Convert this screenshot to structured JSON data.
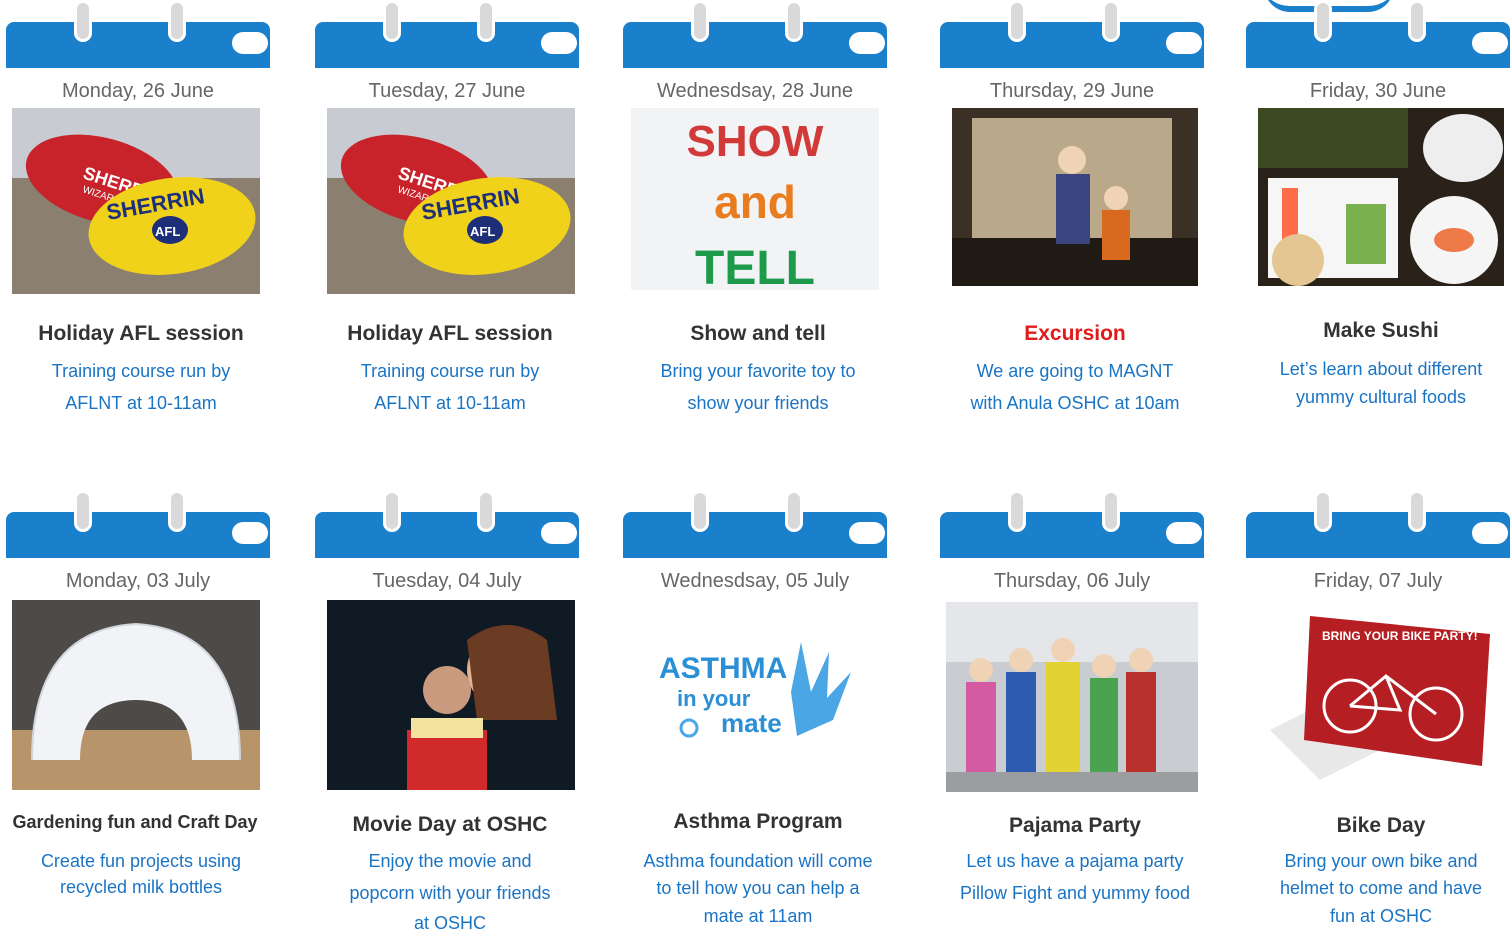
{
  "days": [
    {
      "date": "Monday, 26 June",
      "title": "Holiday AFL session",
      "desc1": "Training course run by",
      "desc2": "AFLNT at 10-11am",
      "img": "afl-footballs",
      "title_style": "normal"
    },
    {
      "date": "Tuesday, 27 June",
      "title": "Holiday AFL session",
      "desc1": "Training course run by",
      "desc2": "AFLNT at 10-11am",
      "img": "afl-footballs",
      "title_style": "normal"
    },
    {
      "date": "Wednesdsay, 28 June",
      "title": "Show and tell",
      "desc1": "Bring your favorite toy to",
      "desc2": "show your friends",
      "img": "show-and-tell",
      "title_style": "normal"
    },
    {
      "date": "Thursday, 29 June",
      "title": "Excursion",
      "desc1": "We are going to MAGNT",
      "desc2": "with Anula OSHC at 10am",
      "img": "museum-kids",
      "title_style": "red"
    },
    {
      "date": "Friday, 30 June",
      "title": "Make Sushi",
      "desc1": "Let’s learn about different",
      "desc2": "yummy cultural foods",
      "img": "sushi",
      "title_style": "normal"
    },
    {
      "date": "Monday, 03 July",
      "title": "Gardening fun and Craft Day",
      "desc1": "Create fun projects using",
      "desc2": "recycled milk bottles",
      "img": "milk-bottle-igloo",
      "title_style": "small"
    },
    {
      "date": "Tuesday, 04 July",
      "title": "Movie Day at OSHC",
      "desc1": "Enjoy the movie and",
      "desc2": "popcorn with your friends",
      "desc3": "at OSHC",
      "img": "cinema-kids",
      "title_style": "normal"
    },
    {
      "date": "Wednesdsay, 05 July",
      "title": "Asthma Program",
      "desc1": "Asthma foundation will come",
      "desc2": "to tell how you can help a",
      "desc3": "mate at 11am",
      "img": "asthma-logo",
      "title_style": "normal"
    },
    {
      "date": "Thursday, 06 July",
      "title": "Pajama Party",
      "desc1": "Let us have a pajama party",
      "desc2": "Pillow Fight and yummy food",
      "img": "pajama-kids",
      "title_style": "normal"
    },
    {
      "date": "Friday, 07 July",
      "title": "Bike Day",
      "desc1": "Bring your own bike and",
      "desc2": "helmet to come and have",
      "desc3": "fun at OSHC",
      "img": "bike-card",
      "title_style": "normal"
    }
  ],
  "image_text": {
    "afl_brand": "SHERRIN",
    "afl_logo": "AFL",
    "afl_sub": "WIZARD",
    "show1": "SHOW",
    "show2": "and",
    "show3": "TELL",
    "asthma1": "ASTHMA",
    "asthma2": "in your",
    "asthma3": "mate",
    "bike_card": "BRING YOUR BIKE PARTY!"
  },
  "colors": {
    "accent": "#1a80cc",
    "link": "#1a74c4",
    "title": "#333333",
    "excursion": "#e11b1b"
  }
}
